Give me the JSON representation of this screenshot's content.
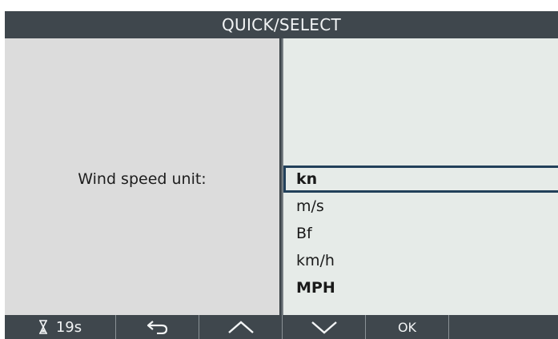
{
  "header": {
    "title": "QUICK/SELECT"
  },
  "prompt": {
    "label": "Wind speed unit:"
  },
  "options": [
    {
      "label": "kn",
      "selected": true
    },
    {
      "label": "m/s",
      "selected": false
    },
    {
      "label": "Bf",
      "selected": false
    },
    {
      "label": "km/h",
      "selected": false
    },
    {
      "label": "MPH",
      "selected": false
    }
  ],
  "footer": {
    "timer_icon": "hourglass-icon",
    "timer_value": "19s",
    "back_icon": "back-arrow-icon",
    "up_icon": "chevron-up-icon",
    "down_icon": "chevron-down-icon",
    "ok_label": "OK"
  },
  "colors": {
    "bar_background": "#3f474d",
    "left_panel": "#dcdcdc",
    "right_panel": "#e6ebe8",
    "selection_border": "#22405a"
  }
}
